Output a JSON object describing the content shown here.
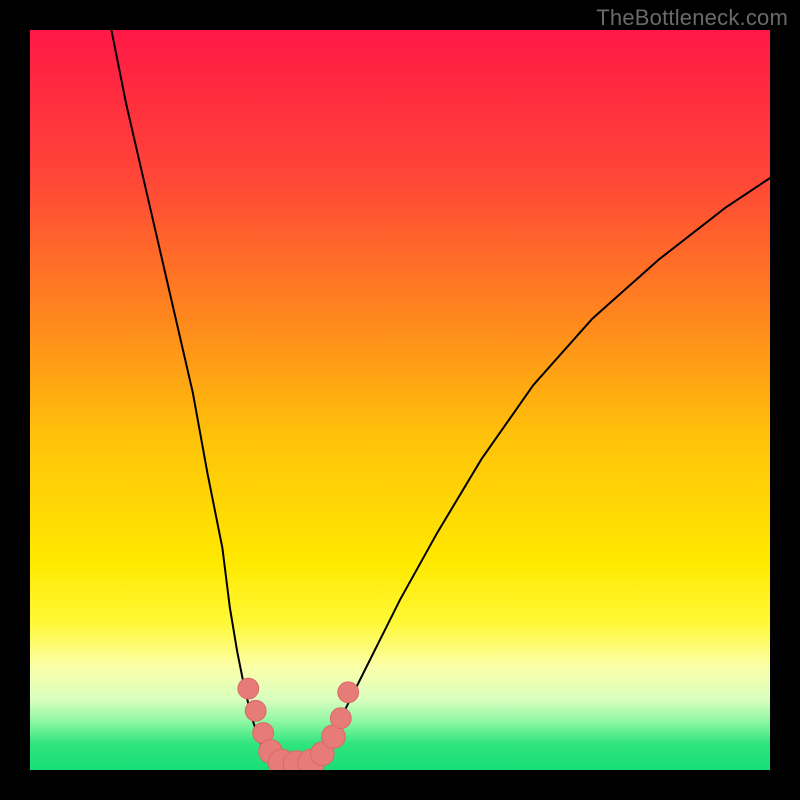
{
  "watermark": "TheBottleneck.com",
  "colors": {
    "frame": "#000000",
    "curve": "#000000",
    "marker_fill": "#e77b78",
    "marker_stroke": "#d86a66"
  },
  "chart_data": {
    "type": "line",
    "title": "",
    "xlabel": "",
    "ylabel": "",
    "xlim": [
      0,
      100
    ],
    "ylim": [
      0,
      100
    ],
    "grid": false,
    "legend": false,
    "background_gradient": {
      "orientation": "vertical",
      "stops": [
        {
          "offset": 0.0,
          "color": "#ff1846"
        },
        {
          "offset": 0.2,
          "color": "#ff4637"
        },
        {
          "offset": 0.4,
          "color": "#ff8b1c"
        },
        {
          "offset": 0.55,
          "color": "#ffc20a"
        },
        {
          "offset": 0.72,
          "color": "#ffe900"
        },
        {
          "offset": 0.8,
          "color": "#fff835"
        },
        {
          "offset": 0.86,
          "color": "#fbffa8"
        },
        {
          "offset": 0.905,
          "color": "#d9ffbf"
        },
        {
          "offset": 0.935,
          "color": "#8cf7a2"
        },
        {
          "offset": 0.965,
          "color": "#2fe47d"
        },
        {
          "offset": 1.0,
          "color": "#18df78"
        }
      ]
    },
    "series": [
      {
        "name": "left-branch",
        "x": [
          11,
          13,
          16,
          19,
          22,
          24,
          26,
          27,
          28,
          29,
          30,
          31,
          32,
          33
        ],
        "y": [
          100,
          90,
          77,
          64,
          51,
          40,
          30,
          22,
          16,
          11,
          7,
          4,
          2,
          1
        ]
      },
      {
        "name": "right-branch",
        "x": [
          38,
          39,
          41,
          43,
          46,
          50,
          55,
          61,
          68,
          76,
          85,
          94,
          100
        ],
        "y": [
          1,
          2,
          5,
          9,
          15,
          23,
          32,
          42,
          52,
          61,
          69,
          76,
          80
        ]
      }
    ],
    "floor_segment": {
      "x_start": 33,
      "x_end": 38,
      "y": 0.5
    },
    "markers": [
      {
        "x": 29.5,
        "y": 11,
        "r": 1.4
      },
      {
        "x": 30.5,
        "y": 8,
        "r": 1.4
      },
      {
        "x": 31.5,
        "y": 5,
        "r": 1.4
      },
      {
        "x": 32.5,
        "y": 2.5,
        "r": 1.6
      },
      {
        "x": 34.0,
        "y": 1.0,
        "r": 1.8
      },
      {
        "x": 36.0,
        "y": 0.8,
        "r": 1.8
      },
      {
        "x": 38.0,
        "y": 1.0,
        "r": 1.8
      },
      {
        "x": 39.5,
        "y": 2.2,
        "r": 1.6
      },
      {
        "x": 41.0,
        "y": 4.5,
        "r": 1.6
      },
      {
        "x": 42.0,
        "y": 7.0,
        "r": 1.4
      },
      {
        "x": 43.0,
        "y": 10.5,
        "r": 1.4
      }
    ]
  }
}
